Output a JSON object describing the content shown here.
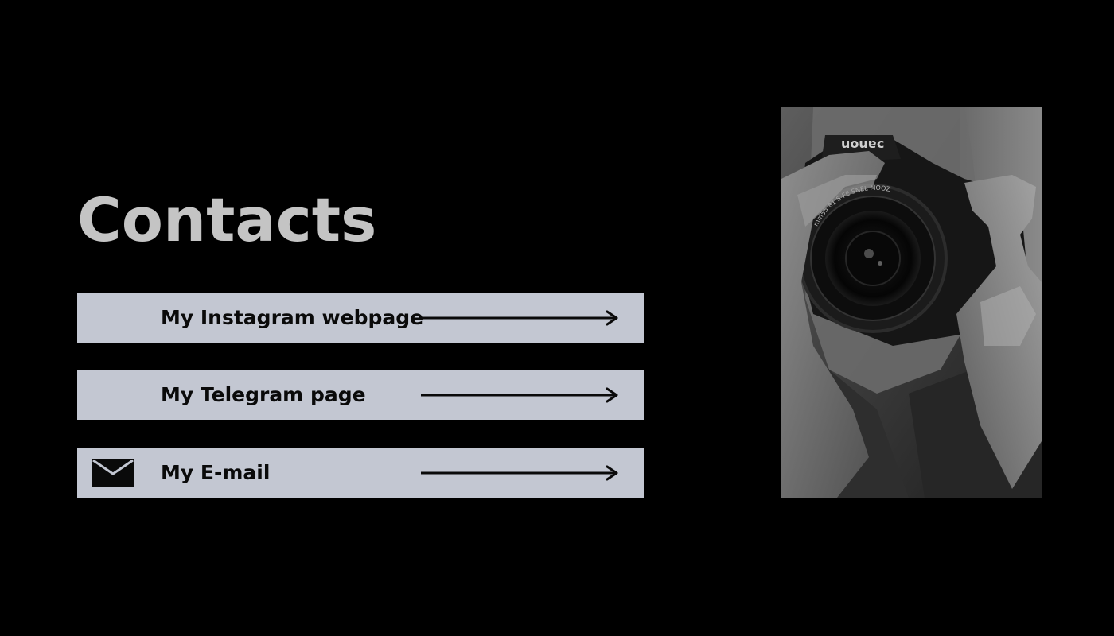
{
  "page": {
    "title": "Contacts"
  },
  "contacts": [
    {
      "label": "My Instagram webpage",
      "icon": "none",
      "arrow_icon": "long-arrow-right-icon"
    },
    {
      "label": "My Telegram page",
      "icon": "none",
      "arrow_icon": "long-arrow-right-icon"
    },
    {
      "label": "My E-mail",
      "icon": "envelope-icon",
      "arrow_icon": "long-arrow-right-icon"
    }
  ],
  "photo": {
    "description_icon": "photographer-with-camera-image",
    "camera_brand": "Canon",
    "lens_text": "CANON ZOOM LENS EF-S 18-55mm 1:3.5-5.6 II"
  },
  "colors": {
    "background": "#000000",
    "title": "#c4c4c4",
    "row_background": "#c3c7d2",
    "row_text": "#0a0a0a"
  }
}
